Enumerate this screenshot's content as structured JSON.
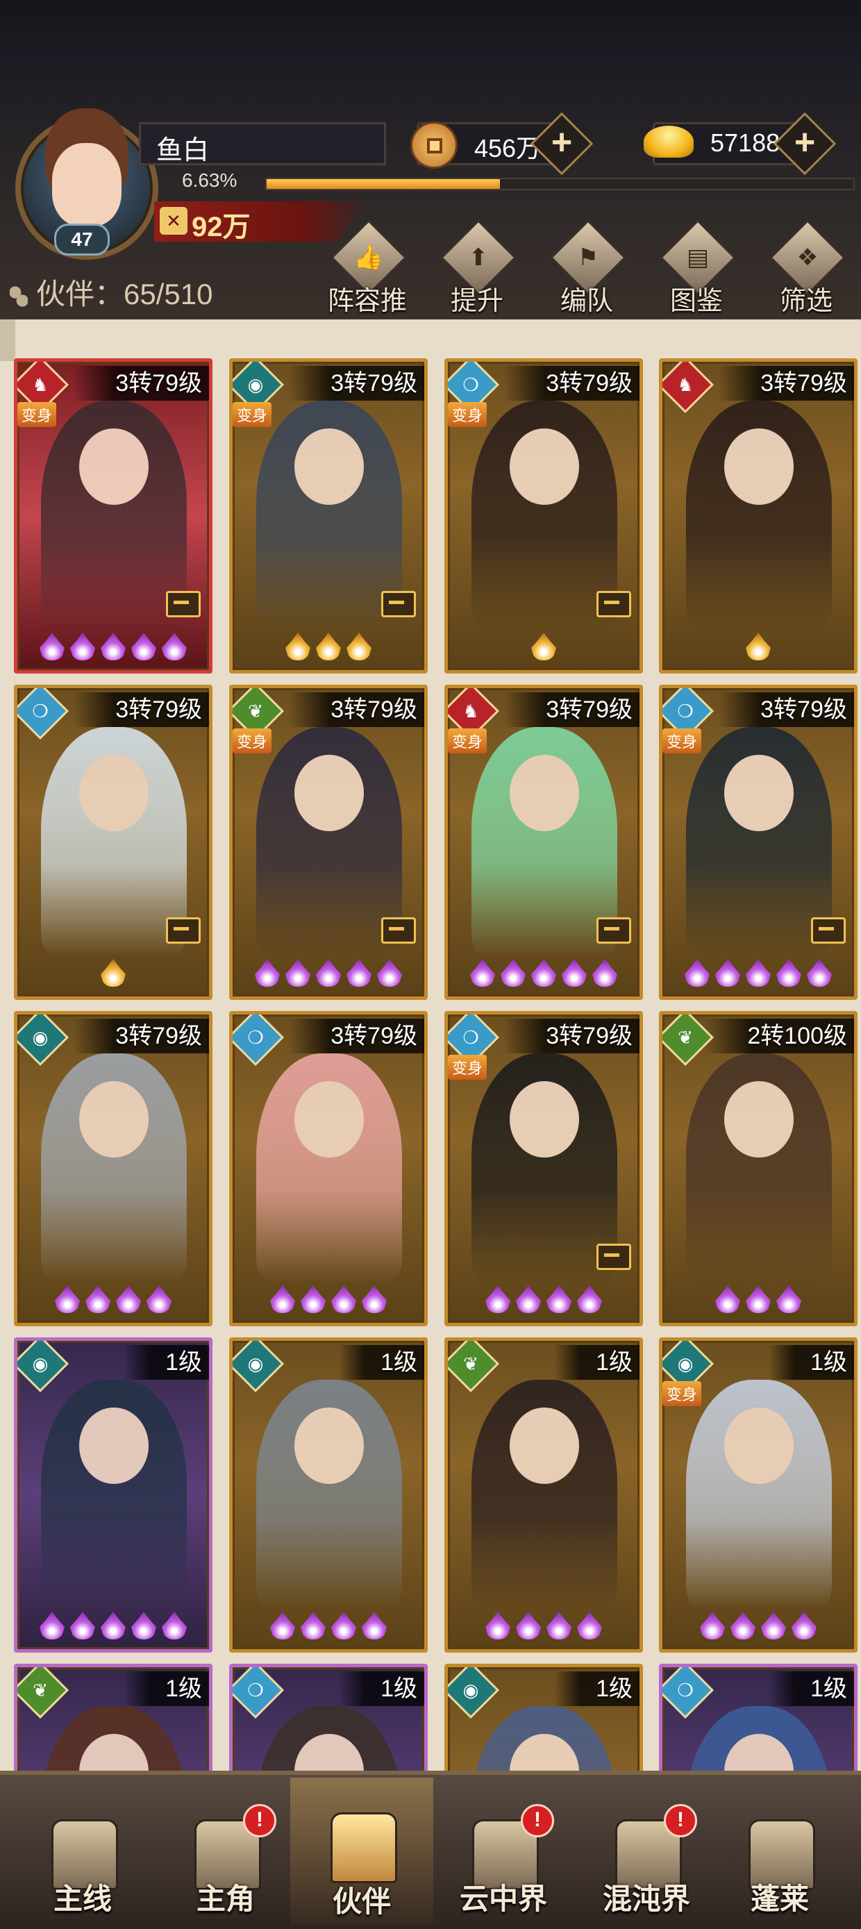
{
  "player": {
    "name": "鱼白",
    "level": "47",
    "exp_percent_label": "6.63%",
    "exp_fraction": 0.0663,
    "power": "92万"
  },
  "currency": {
    "copper": "456万",
    "gold": "57188"
  },
  "partners": {
    "count_label": "伙伴：65/510"
  },
  "toolbar": [
    {
      "label": "阵容推荐",
      "icon": "formation-icon"
    },
    {
      "label": "提升",
      "icon": "upgrade-icon"
    },
    {
      "label": "编队",
      "icon": "team-icon"
    },
    {
      "label": "图鉴",
      "icon": "codex-icon"
    },
    {
      "label": "筛选",
      "icon": "filter-icon"
    }
  ],
  "transform_label": "变身",
  "cards": [
    {
      "level": "3转79级",
      "element": "fire",
      "transform": true,
      "frame": "red",
      "equip": true,
      "stars": 5,
      "star_color": "purple"
    },
    {
      "level": "3转79级",
      "element": "teal",
      "transform": true,
      "frame": "gold",
      "equip": true,
      "stars": 3,
      "star_color": "gold"
    },
    {
      "level": "3转79级",
      "element": "water",
      "transform": true,
      "frame": "gold",
      "equip": true,
      "stars": 1,
      "star_color": "gold"
    },
    {
      "level": "3转79级",
      "element": "fire",
      "transform": false,
      "frame": "gold",
      "equip": false,
      "stars": 1,
      "star_color": "gold"
    },
    {
      "level": "3转79级",
      "element": "water",
      "transform": false,
      "frame": "gold",
      "equip": true,
      "stars": 1,
      "star_color": "gold"
    },
    {
      "level": "3转79级",
      "element": "wood",
      "transform": true,
      "frame": "gold",
      "equip": true,
      "stars": 5,
      "star_color": "purple"
    },
    {
      "level": "3转79级",
      "element": "fire",
      "transform": true,
      "frame": "gold",
      "equip": true,
      "stars": 5,
      "star_color": "purple"
    },
    {
      "level": "3转79级",
      "element": "water",
      "transform": true,
      "frame": "gold",
      "equip": true,
      "stars": 5,
      "star_color": "purple"
    },
    {
      "level": "3转79级",
      "element": "teal",
      "transform": false,
      "frame": "gold",
      "equip": false,
      "stars": 4,
      "star_color": "purple"
    },
    {
      "level": "3转79级",
      "element": "water",
      "transform": false,
      "frame": "gold",
      "equip": false,
      "stars": 4,
      "star_color": "purple"
    },
    {
      "level": "3转79级",
      "element": "water",
      "transform": true,
      "frame": "gold",
      "equip": true,
      "stars": 4,
      "star_color": "purple"
    },
    {
      "level": "2转100级",
      "element": "wood",
      "transform": false,
      "frame": "gold",
      "equip": false,
      "stars": 3,
      "star_color": "purple"
    },
    {
      "level": "1级",
      "element": "teal",
      "transform": false,
      "frame": "purple",
      "equip": false,
      "stars": 5,
      "star_color": "purple"
    },
    {
      "level": "1级",
      "element": "teal",
      "transform": false,
      "frame": "gold",
      "equip": false,
      "stars": 4,
      "star_color": "purple"
    },
    {
      "level": "1级",
      "element": "wood",
      "transform": false,
      "frame": "gold",
      "equip": false,
      "stars": 4,
      "star_color": "purple"
    },
    {
      "level": "1级",
      "element": "teal",
      "transform": true,
      "frame": "gold",
      "equip": false,
      "stars": 4,
      "star_color": "purple"
    },
    {
      "level": "1级",
      "element": "wood",
      "transform": false,
      "frame": "purple",
      "equip": false,
      "stars": 0,
      "star_color": "purple"
    },
    {
      "level": "1级",
      "element": "water",
      "transform": false,
      "frame": "purple",
      "equip": false,
      "stars": 0,
      "star_color": "purple"
    },
    {
      "level": "1级",
      "element": "teal",
      "transform": false,
      "frame": "gold",
      "equip": false,
      "stars": 0,
      "star_color": "purple"
    },
    {
      "level": "1级",
      "element": "water",
      "transform": false,
      "frame": "purple",
      "equip": false,
      "stars": 0,
      "star_color": "purple"
    }
  ],
  "nav": [
    {
      "label": "主线",
      "alert": false,
      "active": false
    },
    {
      "label": "主角",
      "alert": true,
      "active": false
    },
    {
      "label": "伙伴",
      "alert": false,
      "active": true
    },
    {
      "label": "云中界",
      "alert": true,
      "active": false
    },
    {
      "label": "混沌界",
      "alert": true,
      "active": false
    },
    {
      "label": "蓬莱",
      "alert": false,
      "active": false
    }
  ],
  "alert_mark": "!"
}
